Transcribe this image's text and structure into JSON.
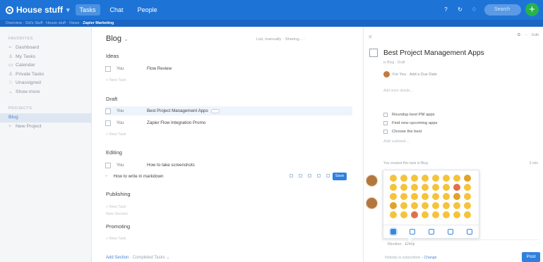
{
  "colors": {
    "accent": "#1e74d6",
    "add_button": "#27b34b",
    "save_button": "#2f80de",
    "selected_sidebar": "#dde6f1"
  },
  "topbar": {
    "app_title": "House stuff",
    "tabs": [
      {
        "label": "Tasks",
        "active": true
      },
      {
        "label": "Chat",
        "active": false
      },
      {
        "label": "People",
        "active": false
      }
    ],
    "search_placeholder": "Search"
  },
  "breadcrumb": {
    "text": "Overview · Sid's Stuff · House stuff · Views ·",
    "current": "Zapier Marketing"
  },
  "sidebar": {
    "favorites_header": "FAVORITES",
    "favorites": [
      "Dashboard",
      "My Tasks",
      "Calendar",
      "Private Tasks",
      "Unassigned",
      "Show more"
    ],
    "projects_header": "PROJECTS",
    "projects": [
      "Blog",
      "New Project"
    ]
  },
  "main": {
    "title": "Blog",
    "tools": "List, manually ·   Sharing... ·",
    "new_task": "New Task",
    "sections": [
      {
        "name": "Ideas",
        "tasks": [
          {
            "assignee": "You",
            "title": "Flow Review"
          }
        ]
      },
      {
        "name": "Draft",
        "tasks": [
          {
            "assignee": "You",
            "title": "Best Project Management Apps"
          },
          {
            "assignee": "You",
            "title": "Zapier Flow Integration Promo"
          }
        ]
      },
      {
        "name": "Editing",
        "tasks": [
          {
            "assignee": "You",
            "title": "How to take screenshots"
          }
        ],
        "editing_value": "How to write in markdown",
        "save_label": "Save"
      },
      {
        "name": "Publishing",
        "tasks": [],
        "extra": "New Section"
      },
      {
        "name": "Promoting",
        "tasks": []
      }
    ],
    "add_section": "Add Section",
    "completed_tasks": "Completed Tasks"
  },
  "detail": {
    "top_actions": "Edit",
    "title": "Best Project Management Apps",
    "subtitle": "in Blog · Draft",
    "assignee": "For You",
    "due_date": "Add a Due Date",
    "description_placeholder": "Add more details…",
    "checklist": [
      "Roundup best PM apps",
      "Find new upcoming apps",
      "Choose the best"
    ],
    "add_subtask": "Add subtask…",
    "activity": "You created this task in Blog",
    "activity_time": "2 min",
    "composer_tools": "Mention  ·  Emoji",
    "subscribe_text": "Nobody is subscribed –",
    "subscribe_link": "Change",
    "post_label": "Post"
  }
}
